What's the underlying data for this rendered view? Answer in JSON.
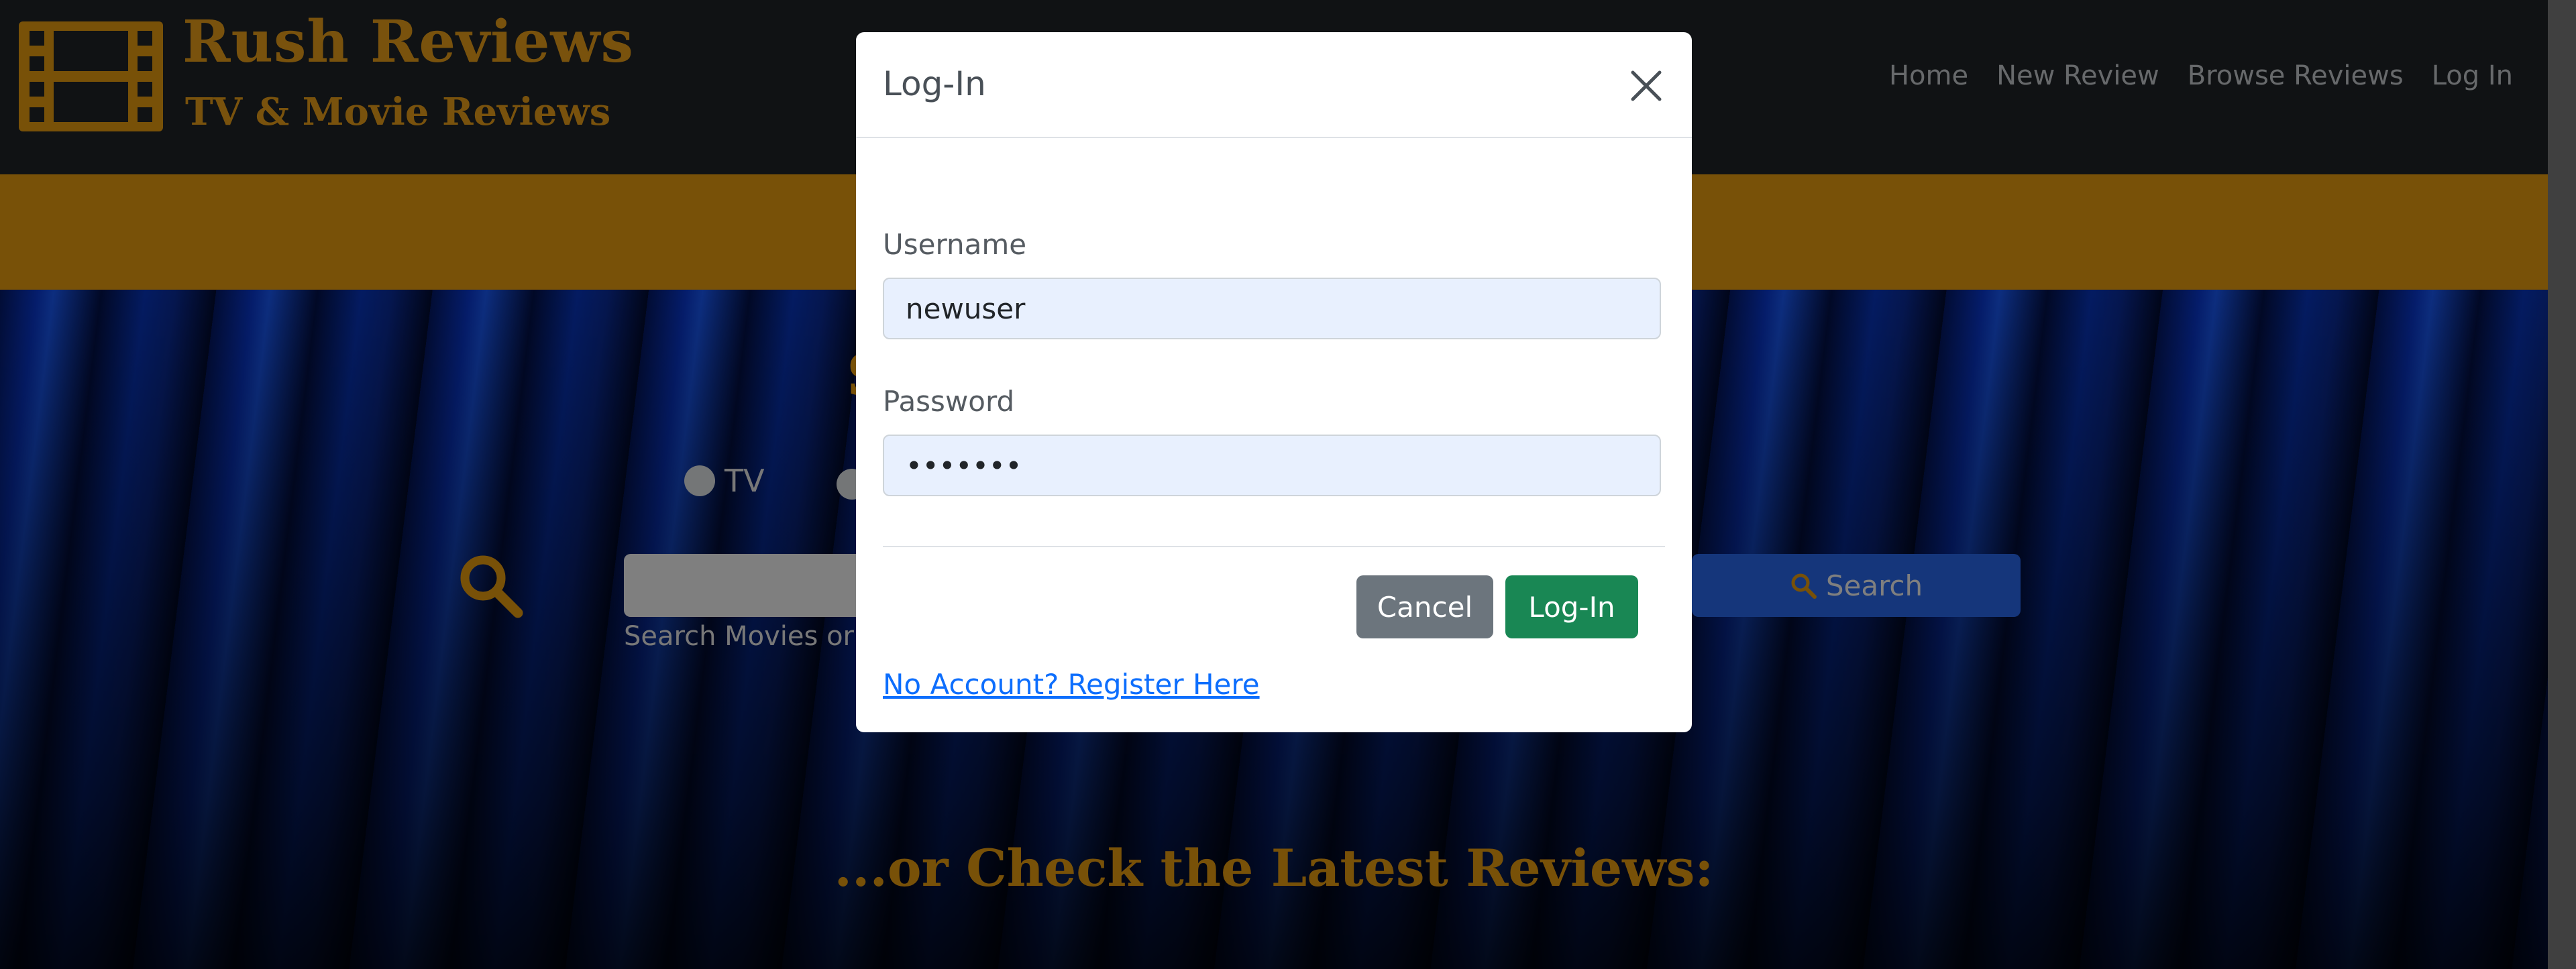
{
  "brand": {
    "title": "Rush Reviews",
    "subtitle": "TV & Movie Reviews",
    "logo_icon": "film-strip-icon"
  },
  "nav": {
    "items": [
      {
        "label": "Home"
      },
      {
        "label": "New Review"
      },
      {
        "label": "Browse Reviews"
      },
      {
        "label": "Log In"
      }
    ]
  },
  "hero": {
    "heading_partial": "S",
    "radio_tv_label": "TV",
    "search_hint": "Search Movies or",
    "search_button_label": "Search",
    "latest_heading": "...or Check the Latest Reviews:"
  },
  "modal": {
    "title": "Log-In",
    "username_label": "Username",
    "username_value": "newuser",
    "password_label": "Password",
    "password_value": "•••••••",
    "cancel_label": "Cancel",
    "login_label": "Log-In",
    "register_link": "No Account? Register Here"
  },
  "colors": {
    "accent_orange": "#f0a211",
    "nav_bg": "#212529",
    "login_green": "#198754",
    "cancel_gray": "#6c757d",
    "link_blue": "#0d6efd"
  }
}
